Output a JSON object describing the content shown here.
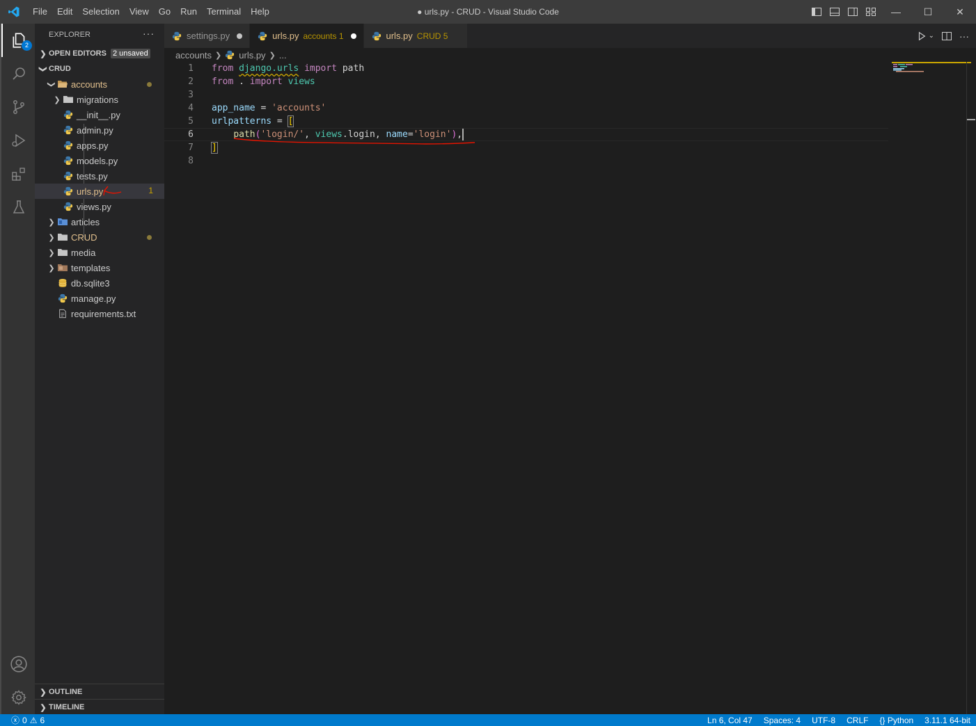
{
  "window": {
    "title": "● urls.py - CRUD - Visual Studio Code"
  },
  "menu": [
    "File",
    "Edit",
    "Selection",
    "View",
    "Go",
    "Run",
    "Terminal",
    "Help"
  ],
  "activity_bar": {
    "explorer_badge": "2"
  },
  "sidebar": {
    "title": "EXPLORER",
    "more": "···",
    "open_editors": {
      "label": "OPEN EDITORS",
      "pill": "2 unsaved"
    },
    "root": "CRUD",
    "tree": [
      {
        "label": "accounts",
        "type": "folder-open",
        "modified": true
      },
      {
        "label": "migrations",
        "type": "folder"
      },
      {
        "label": "__init__.py",
        "type": "python"
      },
      {
        "label": "admin.py",
        "type": "python"
      },
      {
        "label": "apps.py",
        "type": "python"
      },
      {
        "label": "models.py",
        "type": "python"
      },
      {
        "label": "tests.py",
        "type": "python"
      },
      {
        "label": "urls.py",
        "type": "python",
        "modified": true,
        "problems": "1"
      },
      {
        "label": "views.py",
        "type": "python"
      },
      {
        "label": "articles",
        "type": "folder"
      },
      {
        "label": "CRUD",
        "type": "folder",
        "modified": true
      },
      {
        "label": "media",
        "type": "folder"
      },
      {
        "label": "templates",
        "type": "folder"
      },
      {
        "label": "db.sqlite3",
        "type": "database"
      },
      {
        "label": "manage.py",
        "type": "python"
      },
      {
        "label": "requirements.txt",
        "type": "text"
      }
    ],
    "outline": "OUTLINE",
    "timeline": "TIMELINE"
  },
  "tabs": [
    {
      "label": "settings.py",
      "desc": ""
    },
    {
      "label": "urls.py",
      "desc": "accounts 1",
      "active": true
    },
    {
      "label": "urls.py",
      "desc": "CRUD 5"
    }
  ],
  "breadcrumb": {
    "folder": "accounts",
    "file": "urls.py",
    "tail": "..."
  },
  "editor": {
    "line_numbers": [
      "1",
      "2",
      "3",
      "4",
      "5",
      "6",
      "7",
      "8"
    ],
    "active_line": "6",
    "code": {
      "l1": {
        "from": "from",
        "module": "django.urls",
        "import": "import",
        "name": "path"
      },
      "l2": {
        "from": "from",
        "dot": ".",
        "import": "import",
        "name": "views"
      },
      "l4": {
        "var": "app_name",
        "eq": " = ",
        "str": "'accounts'"
      },
      "l5": {
        "var": "urlpatterns",
        "eq": " = ",
        "bracket": "["
      },
      "l6": {
        "fn": "path",
        "open": "(",
        "arg1": "'login/'",
        "comma1": ", ",
        "mod": "views",
        "dot": ".",
        "attr": "login",
        "comma2": ", ",
        "kw": "name",
        "eq": "=",
        "arg2": "'login'",
        "close": ")",
        "comma3": ","
      },
      "l7": {
        "bracket": "]"
      }
    }
  },
  "status": {
    "errors": "0",
    "warnings": "6",
    "position": "Ln 6, Col 47",
    "spaces": "Spaces: 4",
    "encoding": "UTF-8",
    "eol": "CRLF",
    "language": "Python",
    "interpreter": "3.11.1 64-bit"
  },
  "colors": {
    "accent": "#007acc",
    "modified": "#e2c08d",
    "annotation": "#e51400"
  }
}
